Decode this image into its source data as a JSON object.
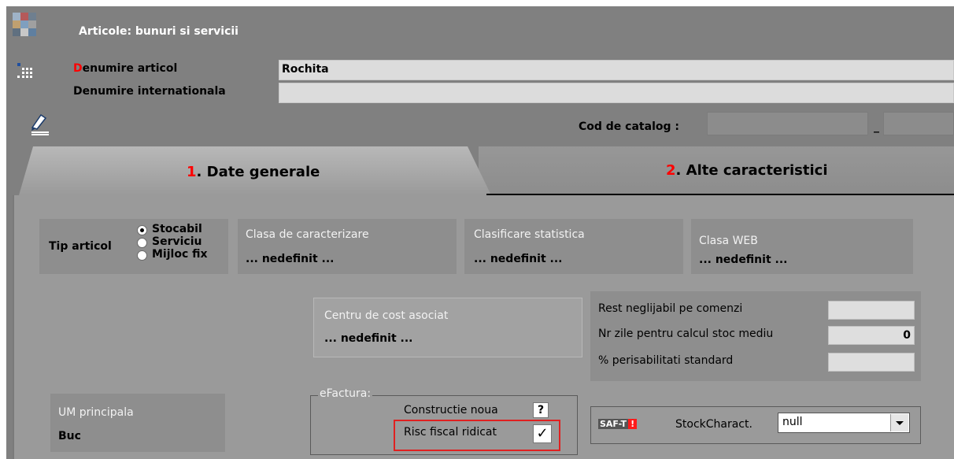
{
  "window": {
    "title": "Articole: bunuri si servicii"
  },
  "header": {
    "name_label_first": "D",
    "name_label_rest": "enumire articol",
    "name_value": "Rochita",
    "intl_label": "Denumire internationala",
    "intl_value": "",
    "catalog_label": "Cod de catalog :",
    "catalog_sep": "_"
  },
  "tabs": [
    {
      "num": "1",
      "label": ". Date generale",
      "active": true
    },
    {
      "num": "2",
      "label": ". Alte caracteristici",
      "active": false
    }
  ],
  "tip": {
    "label": "Tip articol",
    "options": [
      "Stocabil",
      "Serviciu",
      "Mijloc fix"
    ],
    "selected": "Stocabil"
  },
  "classes": [
    {
      "label": "Clasa de caracterizare",
      "value": "... nedefinit ..."
    },
    {
      "label": "Clasificare statistica",
      "value": "... nedefinit ..."
    },
    {
      "label": "Clasa WEB",
      "value": "... nedefinit ..."
    }
  ],
  "cost_center": {
    "label": "Centru de cost asociat",
    "value": "... nedefinit ..."
  },
  "stock_params": [
    {
      "label": "Rest neglijabil pe comenzi",
      "value": ""
    },
    {
      "label": "Nr zile pentru calcul stoc mediu",
      "value": "0"
    },
    {
      "label": "% perisabilitati standard",
      "value": ""
    }
  ],
  "um": {
    "label": "UM principala",
    "value": "Buc"
  },
  "efactura": {
    "legend": "eFactura:",
    "constructie_label": "Constructie noua",
    "constructie_value": "?",
    "risc_label": "Risc fiscal ridicat",
    "risc_value": "✓",
    "highlight_color": "#e02020"
  },
  "saft": {
    "badge": "SAF-T",
    "badge_alert": "!",
    "label": "StockCharact.",
    "value": "null"
  },
  "colors": {
    "background": "#808080",
    "accent_red": "#ff0000",
    "field": "#dcdcdc"
  }
}
